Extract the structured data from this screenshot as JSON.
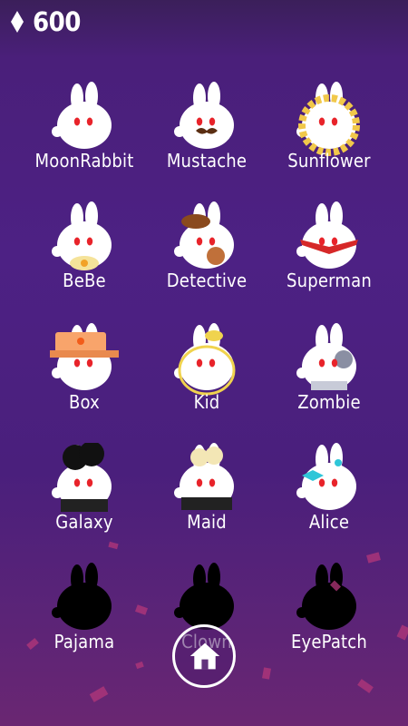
{
  "header": {
    "gem_icon": "diamond-icon",
    "currency": "600"
  },
  "characters": [
    {
      "name": "MoonRabbit",
      "locked": false,
      "accessory": "none"
    },
    {
      "name": "Mustache",
      "locked": false,
      "accessory": "mustache"
    },
    {
      "name": "Sunflower",
      "locked": false,
      "accessory": "petals"
    },
    {
      "name": "BeBe",
      "locked": false,
      "accessory": "bib"
    },
    {
      "name": "Detective",
      "locked": false,
      "accessory": "detective-hat"
    },
    {
      "name": "Superman",
      "locked": false,
      "accessory": "cape"
    },
    {
      "name": "Box",
      "locked": false,
      "accessory": "box-hat"
    },
    {
      "name": "Kid",
      "locked": false,
      "accessory": "yellow-cap"
    },
    {
      "name": "Zombie",
      "locked": false,
      "accessory": "zombie-patch"
    },
    {
      "name": "Galaxy",
      "locked": false,
      "accessory": "afro"
    },
    {
      "name": "Maid",
      "locked": false,
      "accessory": "maid-outfit"
    },
    {
      "name": "Alice",
      "locked": false,
      "accessory": "blue-bow"
    },
    {
      "name": "Pajama",
      "locked": true,
      "accessory": "silhouette"
    },
    {
      "name": "Clown",
      "locked": true,
      "accessory": "silhouette"
    },
    {
      "name": "EyePatch",
      "locked": true,
      "accessory": "silhouette"
    }
  ],
  "footer": {
    "home_icon": "home-icon"
  },
  "colors": {
    "background": "#4d2184",
    "eye": "#e8232a",
    "gem": "#ffffff"
  }
}
